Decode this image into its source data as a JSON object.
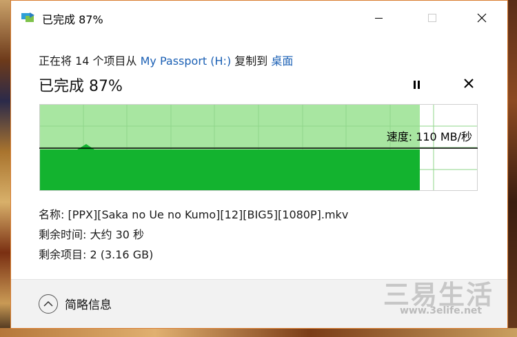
{
  "window": {
    "title": "已完成 87%"
  },
  "copy": {
    "status_prefix": "正在将 14 个项目从 ",
    "source": "My Passport (H:)",
    "middle": " 复制到 ",
    "destination": "桌面",
    "heading": "已完成 87%",
    "percent_complete": 87
  },
  "graph": {
    "speed_label": "速度: 110 MB/秒",
    "colors": {
      "progress_area": "#a8e6a1",
      "throughput_fill": "#13b32f",
      "remaining_area": "#ffffff",
      "grid": "#8fd68a",
      "speed_line": "#000000"
    }
  },
  "details": {
    "name": "名称: [PPX][Saka no Ue no Kumo][12][BIG5][1080P].mkv",
    "time_remaining": "剩余时间: 大约 30 秒",
    "items_remaining": "剩余项目: 2 (3.16 GB)"
  },
  "footer": {
    "label": "简略信息"
  },
  "watermark": {
    "brand": "三易生活",
    "url": "www.3elife.net"
  },
  "icons": {
    "app": "copy-transfer-icon",
    "minimize": "minimize-icon",
    "maximize": "maximize-icon",
    "close": "close-icon",
    "pause": "pause-icon",
    "cancel": "cancel-icon",
    "chevron": "chevron-up-icon"
  },
  "colors": {
    "window_border": "#d87a2a",
    "link": "#1a5fb4",
    "footer_bg": "#f2f2f2"
  }
}
